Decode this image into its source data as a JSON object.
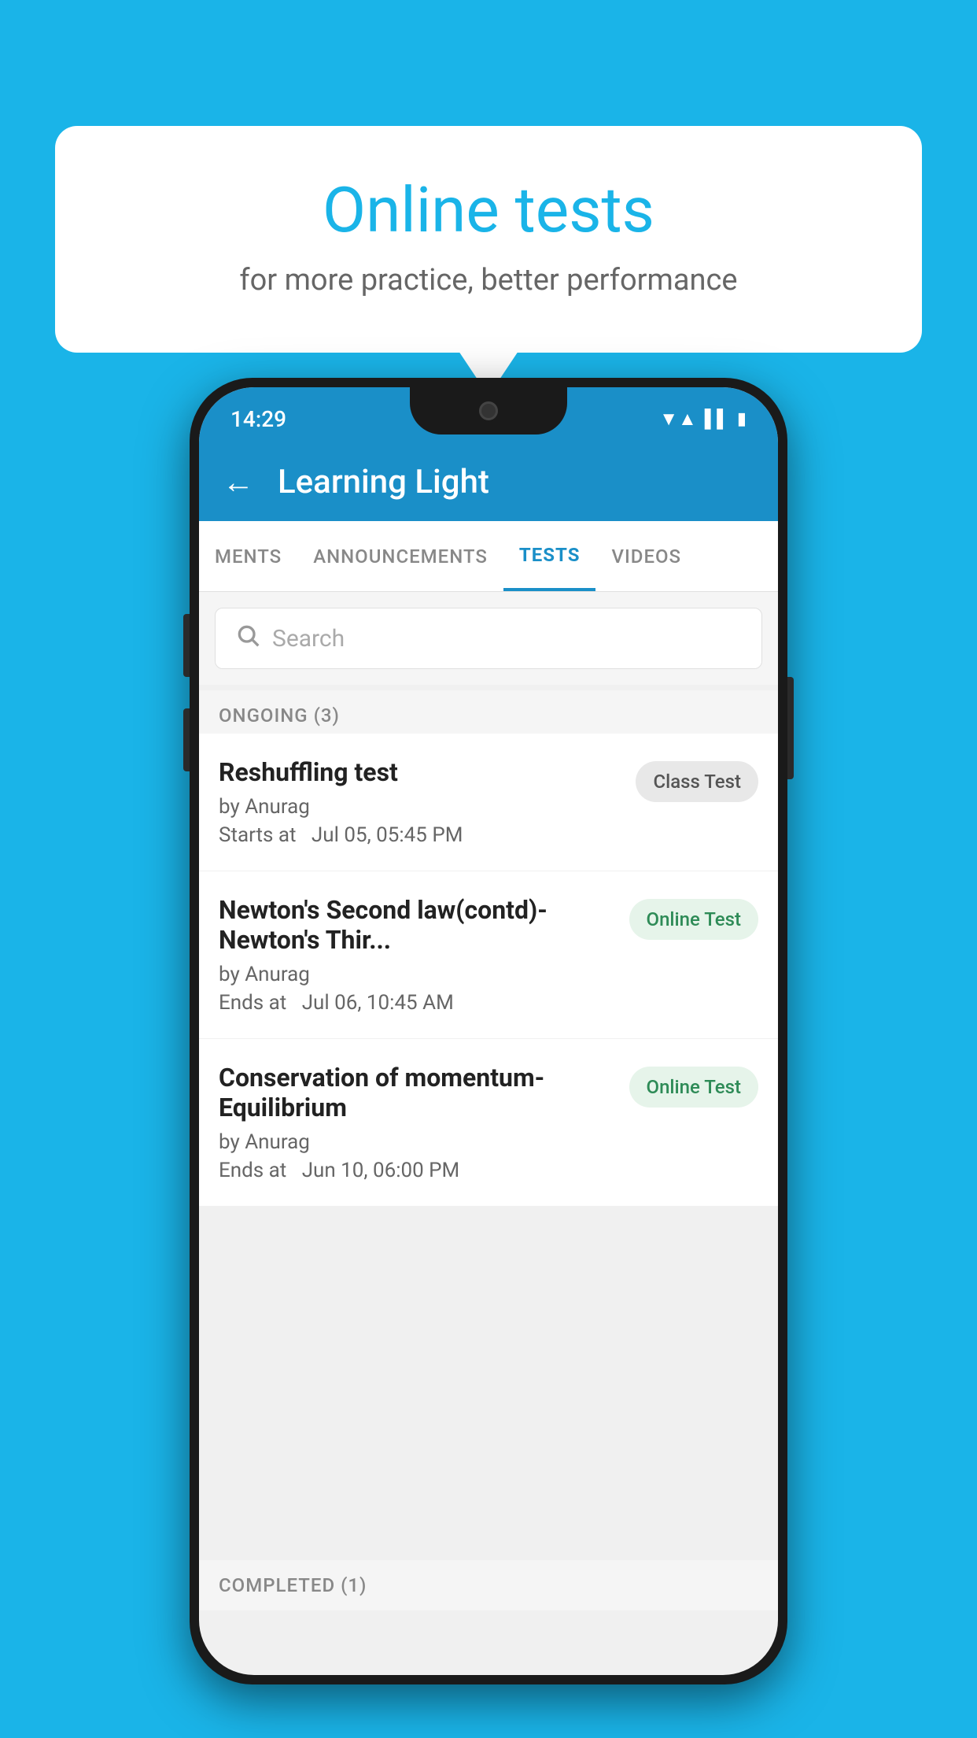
{
  "background_color": "#1ab4e8",
  "bubble": {
    "title": "Online tests",
    "subtitle": "for more practice, better performance"
  },
  "phone": {
    "status_bar": {
      "time": "14:29",
      "icons": [
        "wifi",
        "signal",
        "battery"
      ]
    },
    "app_bar": {
      "back_label": "←",
      "title": "Learning Light"
    },
    "tabs": [
      {
        "label": "MENTS",
        "active": false
      },
      {
        "label": "ANNOUNCEMENTS",
        "active": false
      },
      {
        "label": "TESTS",
        "active": true
      },
      {
        "label": "VIDEOS",
        "active": false
      }
    ],
    "search": {
      "placeholder": "Search"
    },
    "sections": {
      "ongoing": {
        "label": "ONGOING (3)",
        "tests": [
          {
            "name": "Reshuffling test",
            "author": "by Anurag",
            "time_label": "Starts at",
            "time": "Jul 05, 05:45 PM",
            "badge": "Class Test",
            "badge_type": "class"
          },
          {
            "name": "Newton's Second law(contd)-Newton's Thir...",
            "author": "by Anurag",
            "time_label": "Ends at",
            "time": "Jul 06, 10:45 AM",
            "badge": "Online Test",
            "badge_type": "online"
          },
          {
            "name": "Conservation of momentum-Equilibrium",
            "author": "by Anurag",
            "time_label": "Ends at",
            "time": "Jun 10, 06:00 PM",
            "badge": "Online Test",
            "badge_type": "online"
          }
        ]
      },
      "completed": {
        "label": "COMPLETED (1)"
      }
    }
  }
}
